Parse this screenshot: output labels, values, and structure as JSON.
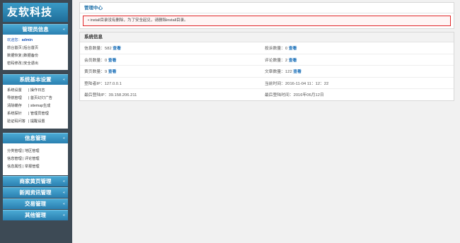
{
  "logo": "友软科技",
  "sidebar": {
    "admin": {
      "title": "管理员信息",
      "welcome_label": "欢迎您：",
      "username": "admin",
      "rows": [
        [
          "前台首页",
          "后台首页"
        ],
        [
          "数据恢复",
          "数据备份"
        ],
        [
          "密码修改",
          "安全退出"
        ]
      ]
    },
    "system": {
      "title": "系统基本设置",
      "rows": [
        [
          "系统设置",
          "操作日志"
        ],
        [
          "导航管理",
          "首页幻灯广告"
        ],
        [
          "清除缓存",
          "sitemap生成"
        ],
        [
          "系统探针",
          "管理员管理"
        ],
        [
          "验证码问答",
          "提醒设置"
        ]
      ]
    },
    "info": {
      "title": "信息管理",
      "rows": [
        [
          "分类管理",
          "地区管理"
        ],
        [
          "信息管理",
          "评论管理"
        ],
        [
          "信息属性",
          "举报管理"
        ]
      ]
    },
    "collapsed": [
      "商家黄页管理",
      "新闻资讯管理",
      "交易管理",
      "其他管理"
    ],
    "arrow": "«"
  },
  "main": {
    "panel_title": "管理中心",
    "alert": "install目录没有删除，为了安全起见，请删除install目录。",
    "sysinfo_title": "系统信息",
    "stats": [
      [
        {
          "label": "信息数量：",
          "value": "582",
          "link": "查看"
        },
        {
          "label": "投诉数量：",
          "value": "0",
          "link": "查看"
        }
      ],
      [
        {
          "label": "会员数量：",
          "value": "0",
          "link": "查看"
        },
        {
          "label": "评论数量：",
          "value": "2",
          "link": "查看"
        }
      ],
      [
        {
          "label": "黄页数量：",
          "value": "9",
          "link": "查看"
        },
        {
          "label": "文章数量：",
          "value": "122",
          "link": "查看"
        }
      ],
      [
        {
          "label": "登陆者IP：",
          "value": "127.0.0.1",
          "link": ""
        },
        {
          "label": "当前时间：",
          "value": "2016-11-04 11：12：22",
          "link": ""
        }
      ],
      [
        {
          "label": "最后登陆IP：",
          "value": "39.158.206.211",
          "link": ""
        },
        {
          "label": "最后登陆时间：",
          "value": "2016年06月12日",
          "link": ""
        }
      ]
    ]
  }
}
